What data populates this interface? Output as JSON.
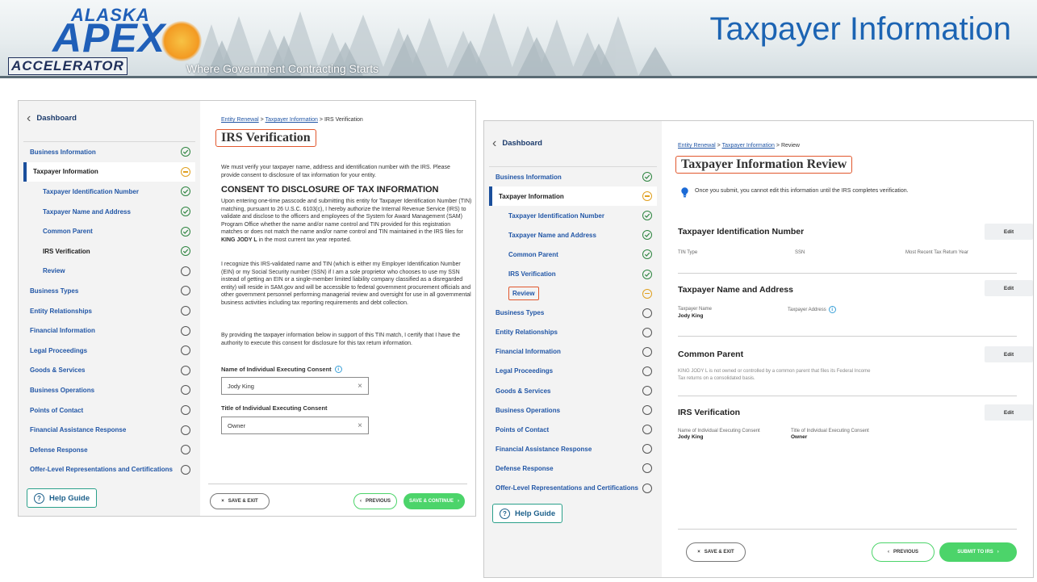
{
  "banner": {
    "logo_top": "ALASKA",
    "logo_main": "APEX",
    "logo_bottom": "ACCELERATOR",
    "tagline": "Where Government Contracting Starts",
    "title": "Taxpayer Information"
  },
  "colors": {
    "brand_blue": "#1c64b3",
    "link_blue": "#2156a6",
    "highlight_orange": "#e1572d",
    "complete_green": "#2e8540",
    "pending_amber": "#e0a020",
    "continue_green": "#4cd46a"
  },
  "left_screen": {
    "sidebar": {
      "back_label": "Dashboard",
      "items": [
        {
          "label": "Business Information",
          "status": "complete"
        },
        {
          "label": "Taxpayer Information",
          "status": "pending"
        },
        {
          "label": "Taxpayer Identification Number",
          "status": "complete"
        },
        {
          "label": "Taxpayer Name and Address",
          "status": "complete"
        },
        {
          "label": "Common Parent",
          "status": "complete"
        },
        {
          "label": "IRS Verification",
          "status": "complete"
        },
        {
          "label": "Review",
          "status": "empty"
        },
        {
          "label": "Business Types",
          "status": "empty"
        },
        {
          "label": "Entity Relationships",
          "status": "empty"
        },
        {
          "label": "Financial Information",
          "status": "empty"
        },
        {
          "label": "Legal Proceedings",
          "status": "empty"
        },
        {
          "label": "Goods & Services",
          "status": "empty"
        },
        {
          "label": "Business Operations",
          "status": "empty"
        },
        {
          "label": "Points of Contact",
          "status": "empty"
        },
        {
          "label": "Financial Assistance Response",
          "status": "empty"
        },
        {
          "label": "Defense Response",
          "status": "empty"
        },
        {
          "label": "Offer-Level Representations and Certifications",
          "status": "empty"
        }
      ],
      "help_label": "Help Guide"
    },
    "breadcrumb": {
      "crumb1": "Entity Renewal",
      "sep": ">",
      "crumb2": "Taxpayer Information",
      "current": "IRS Verification"
    },
    "title": "IRS Verification",
    "intro": "We must verify your taxpayer name, address and identification number with the IRS. Please provide consent to disclosure of tax information for your entity.",
    "consent_heading": "CONSENT TO DISCLOSURE OF TAX INFORMATION",
    "para1_text": "Upon entering one-time passcode and submitting this entity for Taxpayer Identification Number (TIN) matching, pursuant to 26 U.S.C. 6103(c), I hereby authorize the Internal Revenue Service (IRS) to validate and disclose to the officers and employees of the System for Award Management (SAM) Program Office whether the name and/or name control and TIN provided for this registration matches or does not match the name and/or name control and TIN maintained in the IRS files for",
    "para1_name": "KING JODY L",
    "para1_tail": "in the most current tax year reported.",
    "para2": "I recognize this IRS-validated name and TIN (which is either my Employer Identification Number (EIN) or my Social Security number (SSN) if I am a sole proprietor who chooses to use my SSN instead of getting an EIN or a single-member limited liability company classified as a disregarded entity) will reside in SAM.gov and will be accessible to federal government procurement officials and other government personnel performing managerial review and oversight for use in all governmental business activities including tax reporting requirements and debt collection.",
    "para3": "By providing the taxpayer information below in support of this TIN match, I certify that I have the authority to execute this consent for disclosure for this tax return information.",
    "field1_label": "Name of Individual Executing Consent",
    "field1_value": "Jody King",
    "field2_label": "Title of Individual Executing Consent",
    "field2_value": "Owner",
    "clear_glyph": "×",
    "save_exit": "SAVE & EXIT",
    "previous": "PREVIOUS",
    "continue": "SAVE & CONTINUE"
  },
  "right_screen": {
    "sidebar": {
      "back_label": "Dashboard",
      "items": [
        {
          "label": "Business Information",
          "status": "complete"
        },
        {
          "label": "Taxpayer Information",
          "status": "pending"
        },
        {
          "label": "Taxpayer Identification Number",
          "status": "complete"
        },
        {
          "label": "Taxpayer Name and Address",
          "status": "complete"
        },
        {
          "label": "Common Parent",
          "status": "complete"
        },
        {
          "label": "IRS Verification",
          "status": "complete"
        },
        {
          "label": "Review",
          "status": "pending"
        },
        {
          "label": "Business Types",
          "status": "empty"
        },
        {
          "label": "Entity Relationships",
          "status": "empty"
        },
        {
          "label": "Financial Information",
          "status": "empty"
        },
        {
          "label": "Legal Proceedings",
          "status": "empty"
        },
        {
          "label": "Goods & Services",
          "status": "empty"
        },
        {
          "label": "Business Operations",
          "status": "empty"
        },
        {
          "label": "Points of Contact",
          "status": "empty"
        },
        {
          "label": "Financial Assistance Response",
          "status": "empty"
        },
        {
          "label": "Defense Response",
          "status": "empty"
        },
        {
          "label": "Offer-Level Representations and Certifications",
          "status": "empty"
        }
      ],
      "help_label": "Help Guide"
    },
    "breadcrumb": {
      "crumb1": "Entity Renewal",
      "sep": ">",
      "crumb2": "Taxpayer Information",
      "current": "Review"
    },
    "title": "Taxpayer Information Review",
    "notice": "Once you submit, you cannot edit this information until the IRS completes verification.",
    "edit_label": "Edit",
    "tin": {
      "heading": "Taxpayer Identification Number",
      "type_label": "TIN Type",
      "type_value": "SSN",
      "year_label": "Most Recent Tax Return Year"
    },
    "name_addr": {
      "heading": "Taxpayer Name and Address",
      "name_label": "Taxpayer Name",
      "name_value": "Jody King",
      "addr_label": "Taxpayer Address"
    },
    "common_parent": {
      "heading": "Common Parent",
      "note": "KING JODY L is not owned or controlled by a common parent that files its Federal Income Tax returns on a consolidated basis."
    },
    "irs": {
      "heading": "IRS Verification",
      "name_label": "Name of Individual Executing Consent",
      "name_value": "Jody King",
      "title_label": "Title of Individual Executing Consent",
      "title_value": "Owner"
    },
    "save_exit": "SAVE & EXIT",
    "previous": "PREVIOUS",
    "submit": "SUBMIT TO IRS"
  }
}
